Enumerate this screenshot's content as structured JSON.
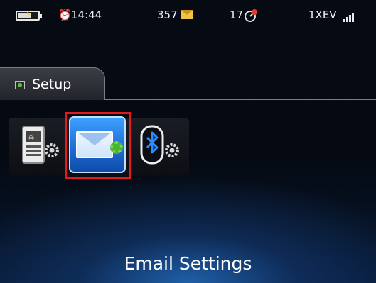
{
  "status_bar": {
    "time": "14:44",
    "message_count": "357",
    "notification_count": "17",
    "network": "1XEV",
    "icons": [
      "battery-charging-icon",
      "alarm-clock-icon",
      "envelope-icon",
      "notification-icon",
      "signal-strength-icon"
    ]
  },
  "tab": {
    "label": "Setup",
    "icon": "setup-folder-icon"
  },
  "setup_icons": [
    {
      "name": "device-settings-icon"
    },
    {
      "name": "email-settings-icon",
      "selected": true
    },
    {
      "name": "bluetooth-settings-icon"
    }
  ],
  "selected_caption": "Email Settings",
  "colors": {
    "highlight": "#e51a1a",
    "selection_tile": "#2a86f0",
    "gear_green": "#4ab534",
    "background_glow": "#1f5fa8"
  }
}
